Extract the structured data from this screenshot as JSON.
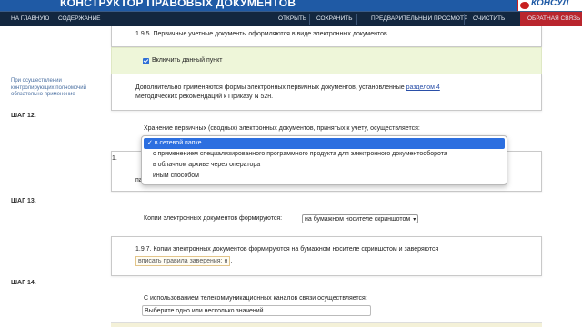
{
  "app": {
    "title": "КОНСТРУКТОР ПРАВОВЫХ ДОКУМЕНТОВ",
    "logo_text": "КОНСУЛ"
  },
  "nav": {
    "home": "НА ГЛАВНУЮ",
    "contents": "СОДЕРЖАНИЕ",
    "open": "ОТКРЫТЬ",
    "save": "СОХРАНИТЬ",
    "preview": "ПРЕДВАРИТЕЛЬНЫЙ ПРОСМОТР",
    "clear": "ОЧИСТИТЬ",
    "feedback": "ОБРАТНАЯ СВЯЗЬ"
  },
  "sidebar_note": "При осуществлении контролирующих полномочий обязательно применение",
  "steps": {
    "s12": "ШАГ 12.",
    "s13": "ШАГ 13.",
    "s14": "ШАГ 14."
  },
  "clause_195": "1.9.5. Первичные учетные документы оформляются в виде электронных документов.",
  "enable_item_label": "Включить данный пункт",
  "additional_text": "Дополнительно применяются формы электронных первичных документов, установленные",
  "additional_link": "разделом 4",
  "additional_tail": "Методических рекомендаций к Приказу N 52н.",
  "storage_label": "Хранение первичных (сводных) электронных документов, принятых к учету, осуществляется:",
  "storage_options": [
    "в сетевой папке",
    "с применением специализированного программного продукта для электронного документооборота",
    "в облачном архиве через оператора",
    "иным способом"
  ],
  "clause_196_partial": "1.",
  "clause_196_partial2": "па",
  "copies_label": "Копии электронных документов формируются:",
  "copies_value": "на бумажном носителе скриншотом",
  "clause_197": "1.9.7. Копии электронных документов формируются на бумажном носителе скриншотом и заверяются",
  "clause_197_input": "вписать правила заверения: н",
  "clause_197_tail": ".",
  "telecom_label": "С использованием телекоммуникационных каналов связи осуществляется:",
  "telecom_placeholder": "Выберите одно или несколько значений ...",
  "colors": {
    "header": "#1f5aa5",
    "navbar": "#13273f",
    "feedback_bg": "#b9252d",
    "selected": "#2c6fe0"
  }
}
